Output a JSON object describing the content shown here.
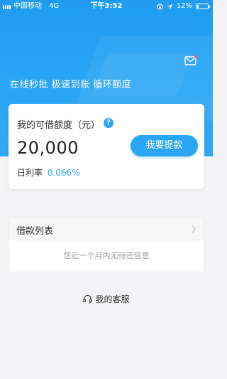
{
  "status_bar": {
    "carrier": "中国移动",
    "network": "4G",
    "time": "下午3:52",
    "battery": "12%",
    "battery_level": 0.12,
    "icons": [
      "signal-icon",
      "orientation-lock-icon",
      "location-icon",
      "battery-icon"
    ]
  },
  "header": {
    "slogan": "在线秒批 极速到账 循环额度",
    "mail_icon": "mail-icon",
    "accent_color": "#2aa6f5"
  },
  "credit_card": {
    "title": "我的可借额度（元）",
    "help_icon": "question-icon",
    "amount": "20,000",
    "rate_label": "日利率",
    "rate_value": "0.066%",
    "withdraw_label": "我要提款"
  },
  "loan_list": {
    "title": "借款列表",
    "chevron_icon": "chevron-right-icon",
    "empty_text": "您近一个月内无待还信息"
  },
  "service": {
    "icon": "headset-icon",
    "label": "我的客服"
  }
}
